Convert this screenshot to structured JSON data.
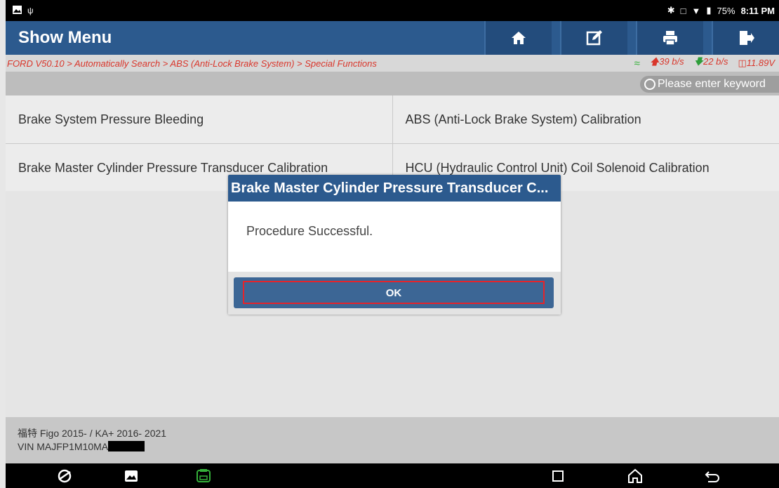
{
  "status_bar": {
    "battery": "75%",
    "time": "8:11 PM"
  },
  "header": {
    "title": "Show Menu",
    "buttons": [
      "home-icon",
      "edit-icon",
      "print-icon",
      "exit-icon"
    ]
  },
  "breadcrumb": {
    "path": "FORD V50.10 > Automatically Search > ABS (Anti-Lock Brake System) > Special Functions",
    "upload": "39 b/s",
    "download": "22 b/s",
    "voltage": "11.89V"
  },
  "search": {
    "placeholder": "Please enter keyword"
  },
  "functions": [
    "Brake System Pressure Bleeding",
    "ABS (Anti-Lock Brake System) Calibration",
    "Brake Master Cylinder Pressure Transducer Calibration",
    "HCU (Hydraulic Control Unit) Coil Solenoid Calibration"
  ],
  "dialog": {
    "title": "Brake Master Cylinder Pressure Transducer C...",
    "message": "Procedure Successful.",
    "ok_label": "OK"
  },
  "vehicle": {
    "model": "福特 Figo 2015-  /  KA+ 2016- 2021",
    "vin": "VIN MAJFP1M10MA"
  },
  "colors": {
    "header_blue": "#2c5a8e",
    "breadcrumb_red": "#d9362b",
    "focus_red": "#e5242b",
    "download_green": "#2e9e3a"
  }
}
